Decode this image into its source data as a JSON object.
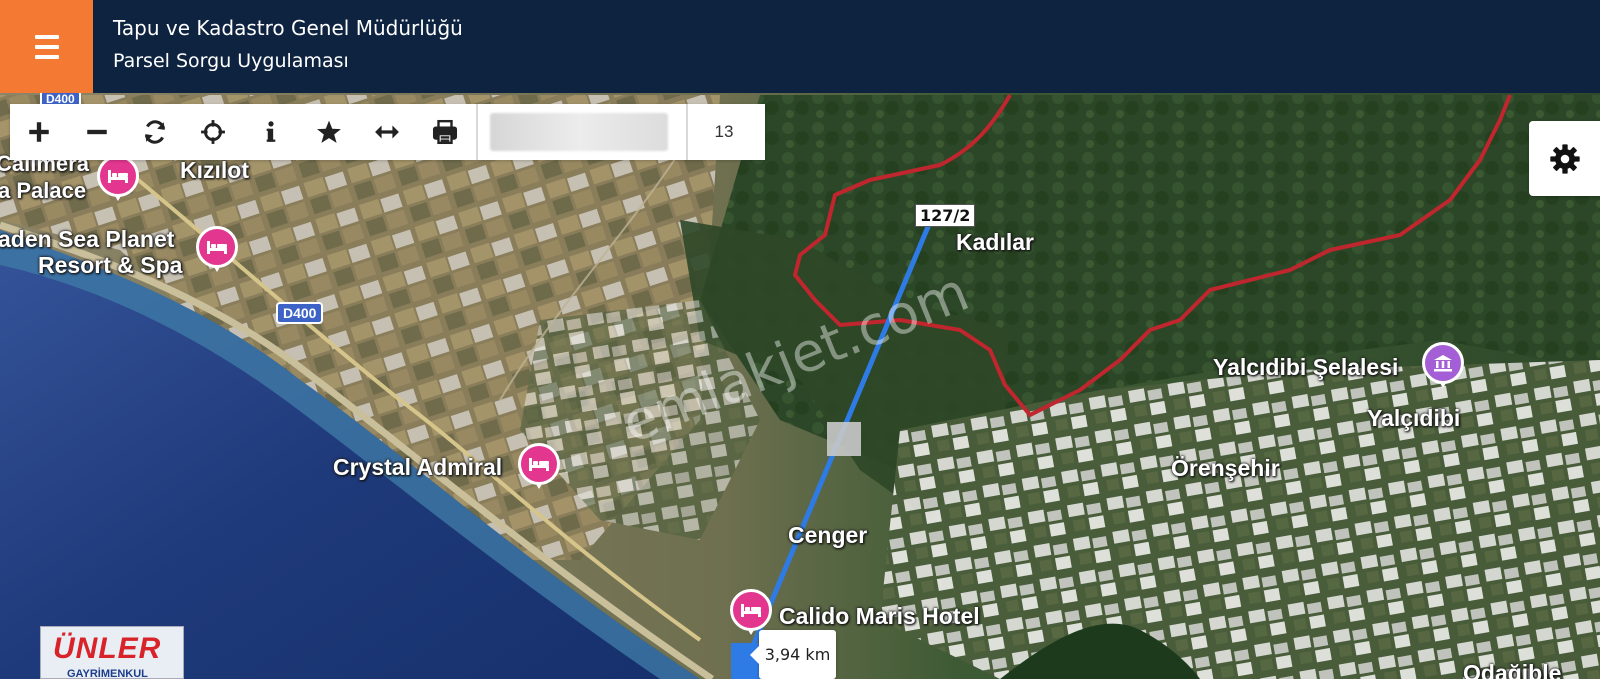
{
  "header": {
    "title_line1": "Tapu ve Kadastro Genel Müdürlüğü",
    "title_line2": "Parsel Sorgu Uygulaması",
    "menu_icon": "hamburger-icon",
    "header_color": "#0e2340",
    "menu_color": "#f47a33"
  },
  "toolbar": {
    "tools": [
      "zoom-in-icon",
      "zoom-out-icon",
      "refresh-icon",
      "locate-icon",
      "info-icon",
      "favorite-icon",
      "measure-icon",
      "print-icon"
    ],
    "zoom_level": "13"
  },
  "settings": {
    "icon": "gear-icon"
  },
  "map": {
    "labels": {
      "kizilot": "Kızılot",
      "calimera": "Calimera",
      "palace": "a Palace",
      "sea_planet_1": "aden Sea Planet",
      "sea_planet_2": "Resort & Spa",
      "crystal_admiral": "Crystal Admiral",
      "kadilar": "Kadılar",
      "yalcidibi_selalesi": "Yalcıdibi Şelalesi",
      "yalcidibi": "Yalçıdibi",
      "orensehir": "Örenşehir",
      "cenger": "Cenger",
      "calido_maris": "Calido Maris Hotel",
      "odagible": "Odağible"
    },
    "road_shields": [
      "D400",
      "D400"
    ],
    "parcel_label": "127/2",
    "distance": "3,94 km",
    "watermark": "emlakjet.com",
    "boundary_color": "#c0262d",
    "route_color": "#2f7be6",
    "hotel_poi_color": "#e2368f",
    "attraction_poi_color": "#a45fd6"
  },
  "logo": {
    "text": "ÜNLER",
    "sub": "GAYRİMENKUL"
  }
}
